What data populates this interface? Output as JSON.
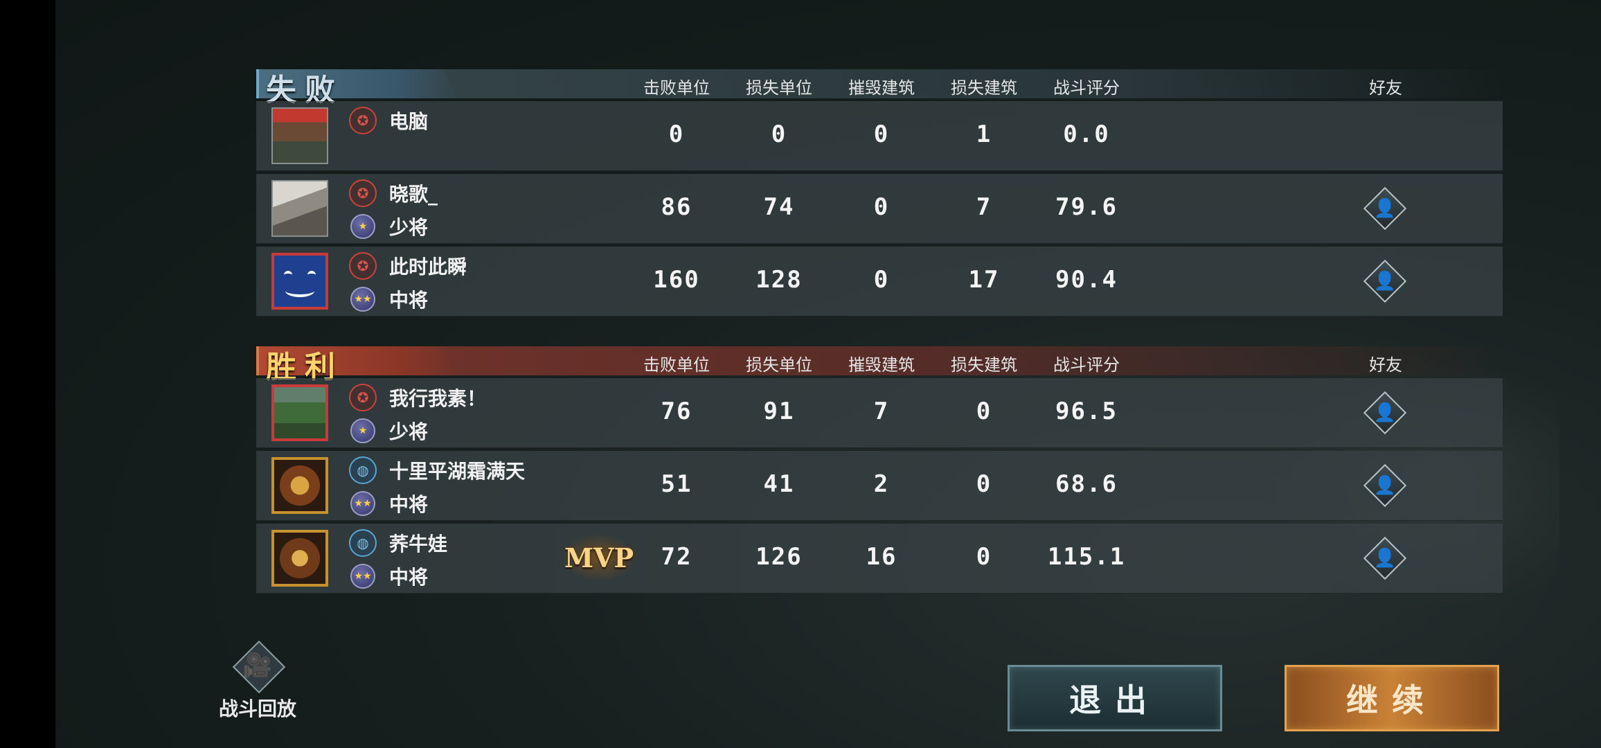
{
  "columns": [
    "击败单位",
    "损失单位",
    "摧毁建筑",
    "损失建筑",
    "战斗评分",
    "好友"
  ],
  "lose": {
    "title": "失败",
    "players": [
      {
        "name": "电脑",
        "rank": "",
        "stats": [
          "0",
          "0",
          "0",
          "1",
          "0.0"
        ],
        "friend": false,
        "faction": "red",
        "mvp": ""
      },
      {
        "name": "晓歌_",
        "rank": "少将",
        "stats": [
          "86",
          "74",
          "0",
          "7",
          "79.6"
        ],
        "friend": true,
        "faction": "red",
        "mvp": ""
      },
      {
        "name": "此时此瞬",
        "rank": "中将",
        "stats": [
          "160",
          "128",
          "0",
          "17",
          "90.4"
        ],
        "friend": true,
        "faction": "red",
        "mvp": ""
      }
    ]
  },
  "win": {
    "title": "胜利",
    "players": [
      {
        "name": "我行我素！",
        "rank": "少将",
        "stats": [
          "76",
          "91",
          "7",
          "0",
          "96.5"
        ],
        "friend": true,
        "faction": "red",
        "mvp": ""
      },
      {
        "name": "十里平湖霜满天",
        "rank": "中将",
        "stats": [
          "51",
          "41",
          "2",
          "0",
          "68.6"
        ],
        "friend": true,
        "faction": "blue",
        "mvp": ""
      },
      {
        "name": "荞牛娃",
        "rank": "中将",
        "stats": [
          "72",
          "126",
          "16",
          "0",
          "115.1"
        ],
        "friend": true,
        "faction": "blue",
        "mvp": "MVP"
      }
    ]
  },
  "replay": {
    "label": "战斗回放",
    "icon": "camera-icon"
  },
  "buttons": {
    "exit": "退出",
    "continue": "继续"
  },
  "colors": {
    "lose_accent": "#4b6f80",
    "win_accent": "#b24a33",
    "continue_accent": "#c98236"
  }
}
